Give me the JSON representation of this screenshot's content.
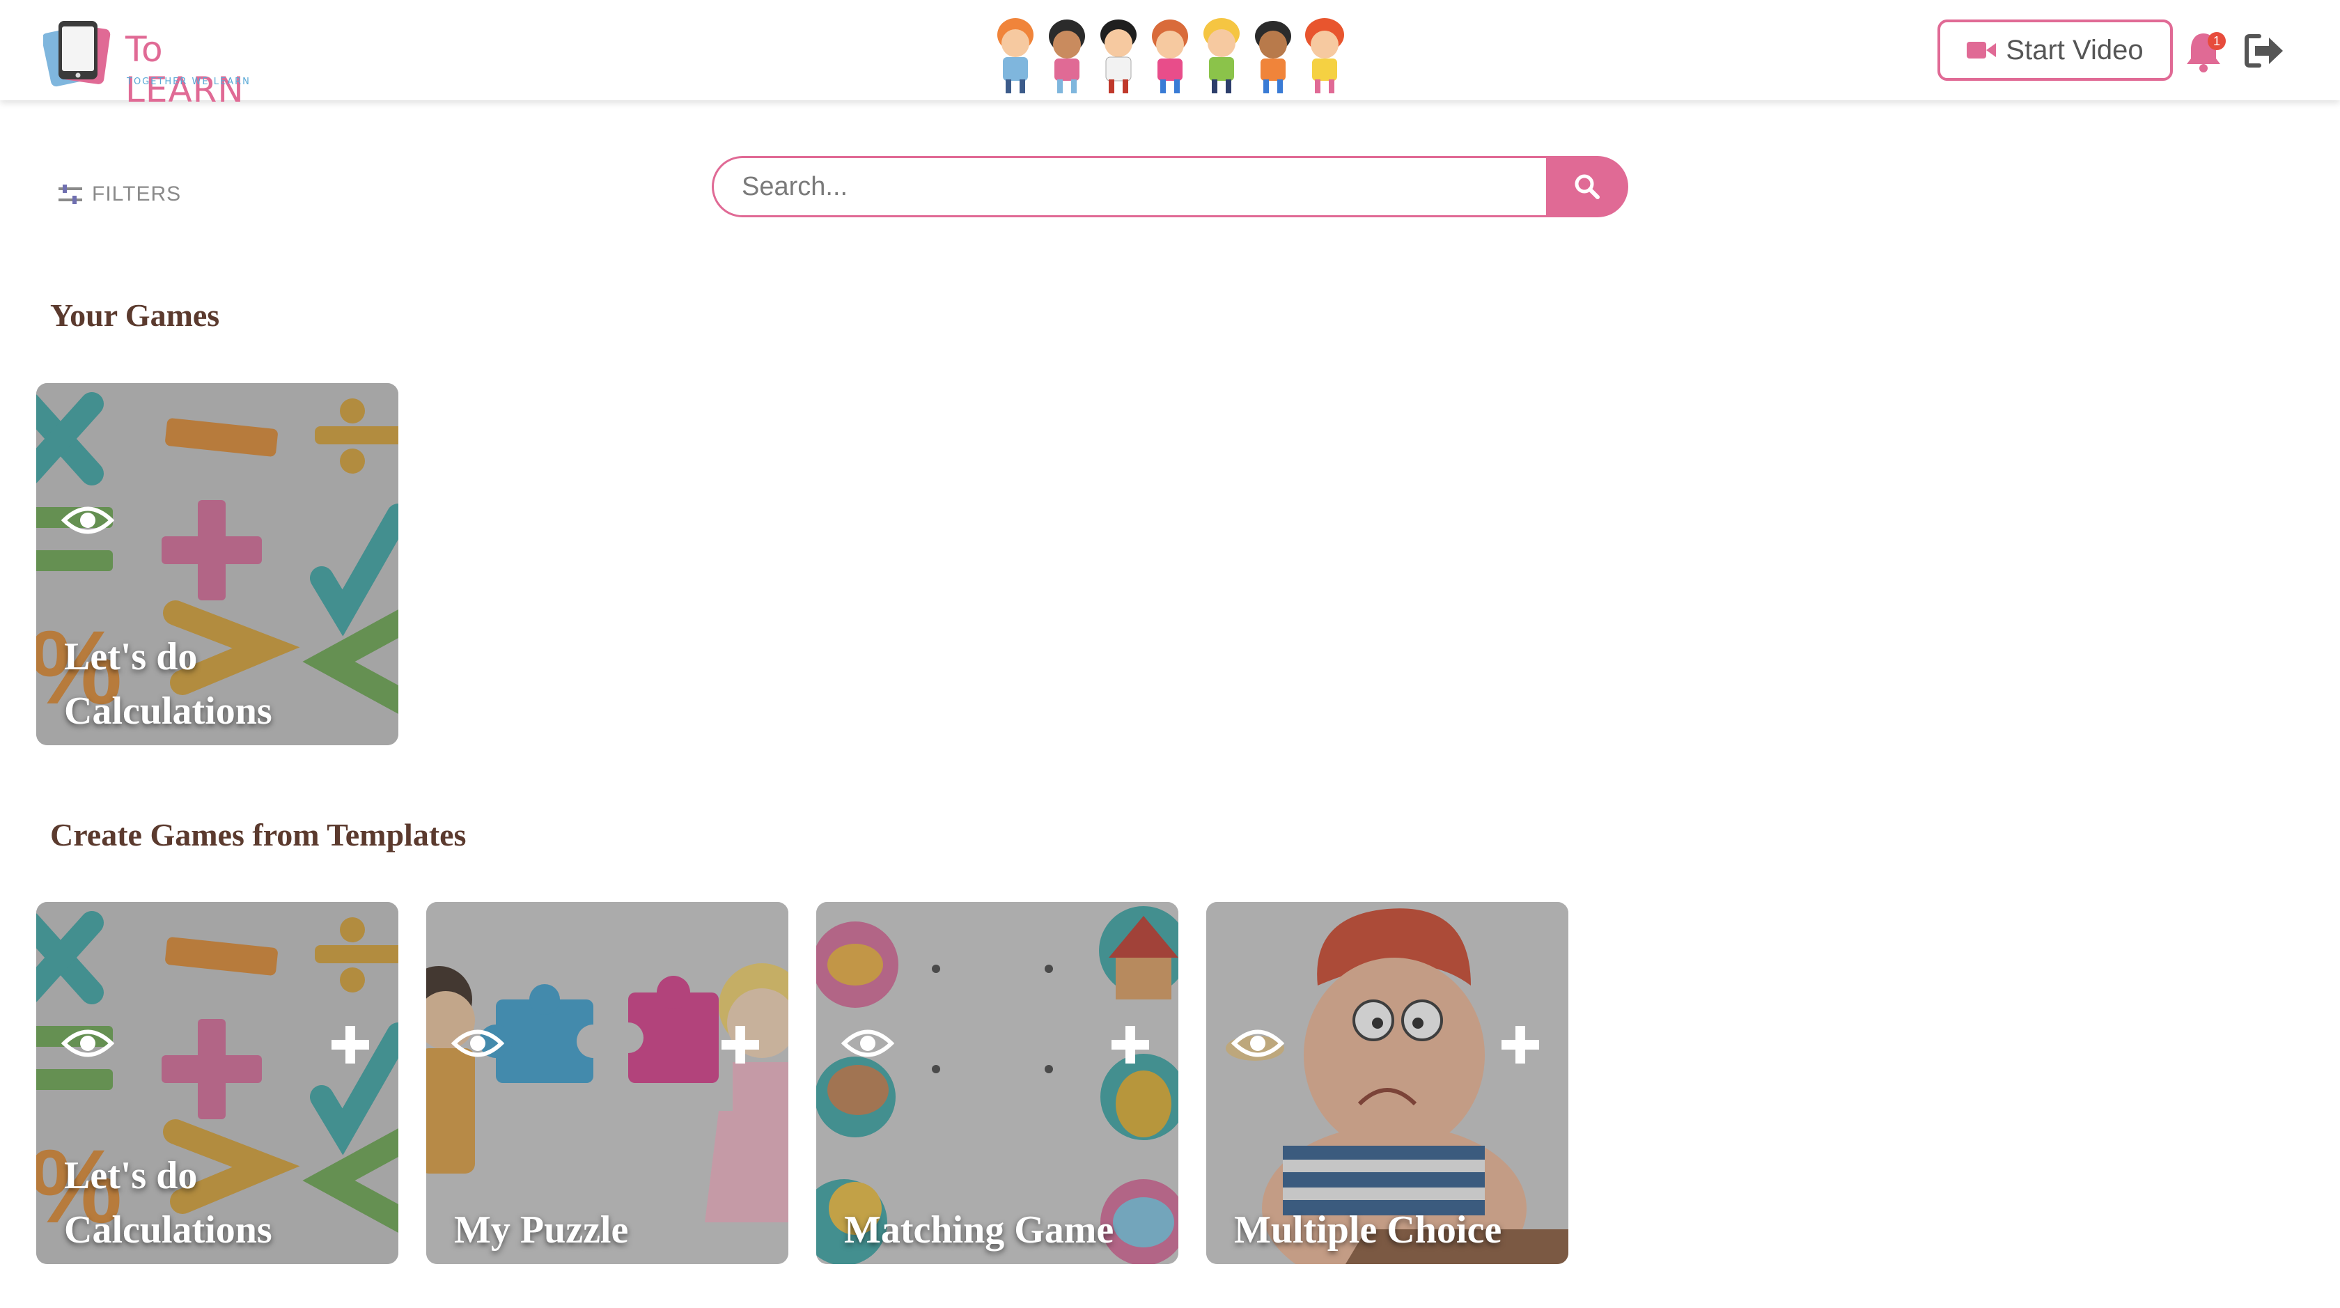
{
  "header": {
    "logo_text": "To LEARN",
    "logo_tagline": "TOGETHER WE LEARN",
    "start_video_label": "Start Video",
    "notification_count": "1",
    "icons": {
      "video": "video-camera-icon",
      "bell": "bell-icon",
      "logout": "logout-icon"
    }
  },
  "filters": {
    "label": "FILTERS",
    "icon": "sliders-icon"
  },
  "search": {
    "placeholder": "Search...",
    "value": "",
    "icon": "search-icon"
  },
  "your_games": {
    "heading": "Your Games",
    "cards": [
      {
        "title": "Let's do Calculations",
        "theme": "math-symbols",
        "actions": [
          "view"
        ]
      }
    ]
  },
  "templates": {
    "heading": "Create Games from Templates",
    "cards": [
      {
        "title": "Let's do Calculations",
        "theme": "math-symbols",
        "actions": [
          "view",
          "add"
        ]
      },
      {
        "title": "My Puzzle",
        "theme": "puzzle",
        "actions": [
          "view",
          "add"
        ]
      },
      {
        "title": "Matching Game",
        "theme": "matching",
        "actions": [
          "view",
          "add"
        ]
      },
      {
        "title": "Multiple Choice",
        "theme": "thinking-boy",
        "actions": [
          "view",
          "add"
        ]
      }
    ]
  },
  "colors": {
    "accent": "#e06a95",
    "heading": "#5b3a2e",
    "badge": "#e74c3c"
  }
}
